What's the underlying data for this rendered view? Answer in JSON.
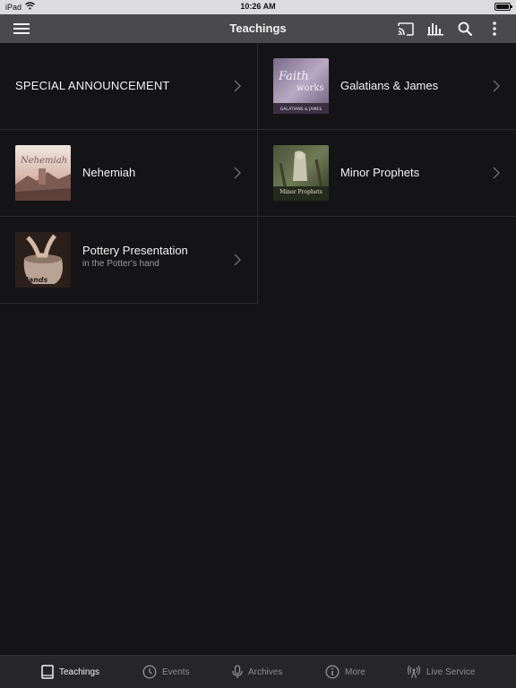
{
  "status_bar": {
    "device": "iPad",
    "time": "10:26 AM"
  },
  "nav_bar": {
    "title": "Teachings",
    "icons": [
      "menu-icon",
      "cast-icon",
      "audio-bars-icon",
      "search-icon",
      "more-vertical-icon"
    ]
  },
  "teachings": [
    {
      "title": "SPECIAL ANNOUNCEMENT",
      "subtitle": "",
      "thumb": "none"
    },
    {
      "title": "Galatians & James",
      "subtitle": "",
      "thumb": "faith-works-art",
      "thumb_caption": "GALATIANS & JAMES"
    },
    {
      "title": "Nehemiah",
      "subtitle": "",
      "thumb": "nehemiah-art"
    },
    {
      "title": "Minor Prophets",
      "subtitle": "",
      "thumb": "minor-prophets-art",
      "thumb_caption": "Minor Prophets"
    },
    {
      "title": "Pottery Presentation",
      "subtitle": "in the Potter's hand",
      "thumb": "pottery-art"
    }
  ],
  "tabs": [
    {
      "label": "Teachings",
      "icon": "book-icon",
      "active": true
    },
    {
      "label": "Events",
      "icon": "clock-icon",
      "active": false
    },
    {
      "label": "Archives",
      "icon": "microphone-icon",
      "active": false
    },
    {
      "label": "More",
      "icon": "info-icon",
      "active": false
    },
    {
      "label": "Live Service",
      "icon": "broadcast-icon",
      "active": false
    }
  ],
  "colors": {
    "background": "#141416",
    "nav_bar": "#4a4a4c",
    "tab_bar": "#262628",
    "active_tab": "#f2f2f2",
    "inactive_tab": "#8e8e90"
  }
}
